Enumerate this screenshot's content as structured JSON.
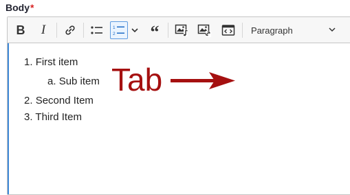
{
  "field": {
    "label": "Body",
    "required_marker": "*"
  },
  "toolbar": {
    "buttons": [
      {
        "name": "bold-button",
        "icon": "bold-icon",
        "glyph": "B"
      },
      {
        "name": "italic-button",
        "icon": "italic-icon",
        "glyph": "I"
      },
      {
        "name": "link-button",
        "icon": "link-icon"
      },
      {
        "name": "bulleted-list-button",
        "icon": "bulleted-list-icon"
      },
      {
        "name": "numbered-list-button",
        "icon": "numbered-list-icon",
        "active": true
      },
      {
        "name": "numbered-list-options-button",
        "icon": "chevron-down-icon"
      },
      {
        "name": "block-quote-button",
        "icon": "quote-icon",
        "glyph": "“"
      },
      {
        "name": "insert-media-button",
        "icon": "media-icon"
      },
      {
        "name": "insert-image-button",
        "icon": "image-icon"
      },
      {
        "name": "embed-code-button",
        "icon": "code-block-icon"
      }
    ],
    "heading_select": "Paragraph"
  },
  "content": {
    "items": [
      {
        "marker": "1.",
        "text": "First item"
      },
      {
        "marker": "a.",
        "text": "Sub item"
      },
      {
        "marker": "2.",
        "text": "Second Item"
      },
      {
        "marker": "3.",
        "text": "Third Item"
      }
    ],
    "annotation": "Tab"
  },
  "colors": {
    "accent": "#3f89d8",
    "annotation": "#a51010",
    "required": "#d72222"
  }
}
